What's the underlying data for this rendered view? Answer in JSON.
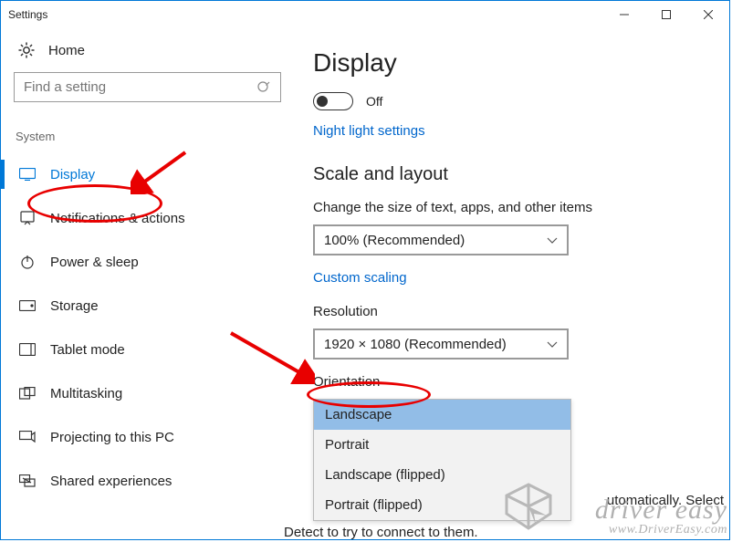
{
  "window": {
    "title": "Settings"
  },
  "sidebar": {
    "home": "Home",
    "search_placeholder": "Find a setting",
    "section": "System",
    "items": [
      {
        "label": "Display"
      },
      {
        "label": "Notifications & actions"
      },
      {
        "label": "Power & sleep"
      },
      {
        "label": "Storage"
      },
      {
        "label": "Tablet mode"
      },
      {
        "label": "Multitasking"
      },
      {
        "label": "Projecting to this PC"
      },
      {
        "label": "Shared experiences"
      }
    ]
  },
  "main": {
    "title": "Display",
    "toggle_label": "Off",
    "night_link": "Night light settings",
    "scale_heading": "Scale and layout",
    "scale_caption": "Change the size of text, apps, and other items",
    "scale_value": "100% (Recommended)",
    "custom_link": "Custom scaling",
    "resolution_label": "Resolution",
    "resolution_value": "1920 × 1080 (Recommended)",
    "orientation_label": "Orientation",
    "orientation_options": [
      "Landscape",
      "Portrait",
      "Landscape (flipped)",
      "Portrait (flipped)"
    ],
    "truncated_right": "utomatically. Select",
    "truncated_bottom": "Detect to try to connect to them."
  },
  "watermark": {
    "line1": "driver easy",
    "line2": "www.DriverEasy.com"
  }
}
